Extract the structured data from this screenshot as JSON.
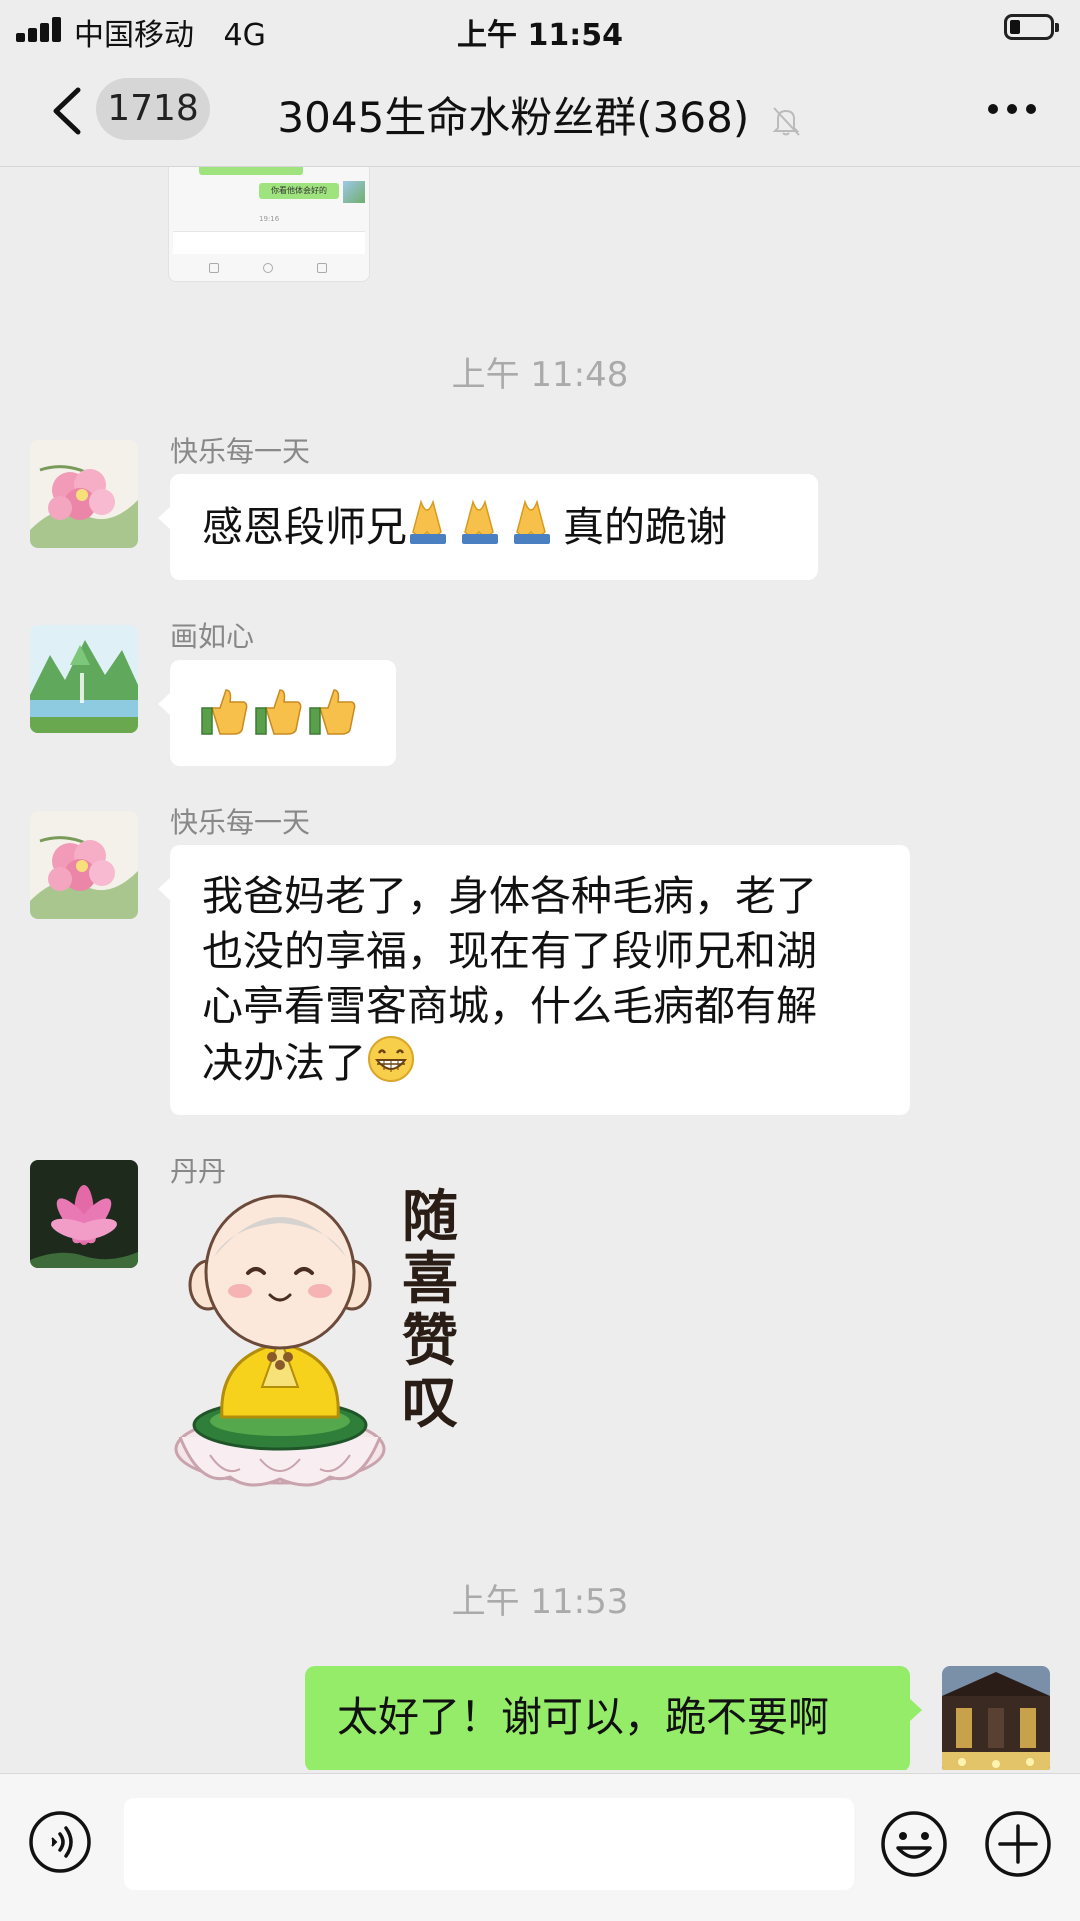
{
  "status_bar": {
    "carrier": "中国移动",
    "network": "4G",
    "time": "上午 11:54",
    "battery_level": 0.25
  },
  "nav_bar": {
    "unread_count": "1718",
    "group_name": "3045生命水粉丝群",
    "member_count": "(368)",
    "muted": true
  },
  "chat": {
    "preview_image_text": "你看他体会好的",
    "preview_image_time": "19:16",
    "time_divider_1": "上午 11:48",
    "time_divider_2": "上午 11:53",
    "messages": [
      {
        "sender": "快乐每一天",
        "avatar_icon": "pink-blossom-avatar",
        "text_before": "感恩段师兄",
        "emoji": "folded-hands-emoji",
        "emoji_count": 3,
        "text_after": "真的跪谢"
      },
      {
        "sender": "画如心",
        "avatar_icon": "landscape-avatar",
        "emoji": "thumbs-up-emoji",
        "emoji_count": 3
      },
      {
        "sender": "快乐每一天",
        "avatar_icon": "pink-blossom-avatar",
        "lines": [
          "我爸妈老了，身体各种毛病，老了",
          "也没的享福，现在有了段师兄和湖",
          "心亭看雪客商城，什么毛病都有解",
          "决办法了"
        ],
        "emoji": "grinning-face-emoji"
      },
      {
        "sender": "丹丹",
        "avatar_icon": "lotus-avatar",
        "sticker_text": [
          "随",
          "喜",
          "赞",
          "叹"
        ],
        "sticker_icon": "praying-monk-sticker"
      },
      {
        "sender_is_me": true,
        "avatar_icon": "temple-avatar",
        "text": "太好了！谢可以，跪不要啊"
      }
    ]
  },
  "input_bar": {
    "voice_icon": "voice-icon",
    "emoji_icon": "smiley-icon",
    "plus_icon": "plus-icon"
  },
  "colors": {
    "background": "#ededed",
    "my_bubble": "#95ec69",
    "other_bubble": "#ffffff",
    "time_text": "#aaaaaa"
  }
}
